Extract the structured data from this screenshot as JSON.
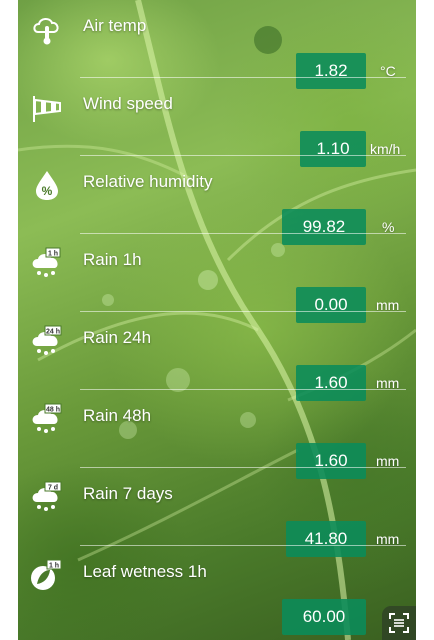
{
  "sensors": [
    {
      "label": "Air temp",
      "value": "1.82",
      "unit": "°C",
      "icon": "thermometer-cloud-icon"
    },
    {
      "label": "Wind speed",
      "value": "1.10",
      "unit": "km/h",
      "icon": "windsock-icon"
    },
    {
      "label": "Relative humidity",
      "value": "99.82",
      "unit": "%",
      "icon": "humidity-drop-icon"
    },
    {
      "label": "Rain 1h",
      "value": "0.00",
      "unit": "mm",
      "icon": "rain-1h-icon",
      "badge": "1 h"
    },
    {
      "label": "Rain 24h",
      "value": "1.60",
      "unit": "mm",
      "icon": "rain-24h-icon",
      "badge": "24 h"
    },
    {
      "label": "Rain 48h",
      "value": "1.60",
      "unit": "mm",
      "icon": "rain-48h-icon",
      "badge": "48 h"
    },
    {
      "label": "Rain 7 days",
      "value": "41.80",
      "unit": "mm",
      "icon": "rain-7d-icon",
      "badge": "7 d"
    },
    {
      "label": "Leaf wetness 1h",
      "value": "60.00",
      "unit": "",
      "icon": "leaf-wetness-icon",
      "badge": "1 h"
    }
  ],
  "colors": {
    "value_bg": "#0a8c5a",
    "text": "#ffffff"
  },
  "scan_button_icon": "scan-icon"
}
